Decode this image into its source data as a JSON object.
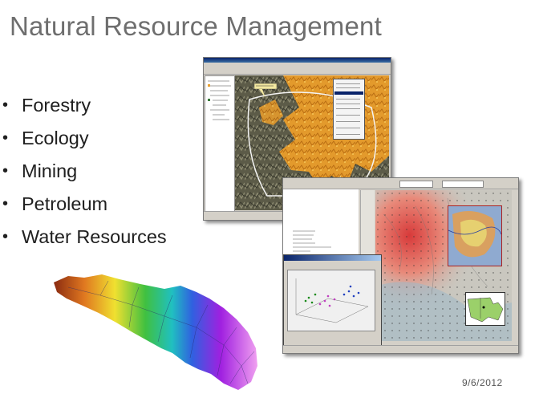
{
  "slide": {
    "title": "Natural Resource Management",
    "bullets": [
      "Forestry",
      "Ecology",
      "Mining",
      "Petroleum",
      "Water Resources"
    ],
    "date": "9/6/2012"
  },
  "images": {
    "gis_screenshot_1": "forest-fire-map-screenshot",
    "gis_screenshot_2": "geostatistical-analysis-screenshot",
    "watershed": "watershed-elevation-map"
  },
  "colors": {
    "title": "#6e6e6e",
    "text": "#202020",
    "fire_orange": "#e8a030",
    "terrain": "#6b6a55"
  }
}
